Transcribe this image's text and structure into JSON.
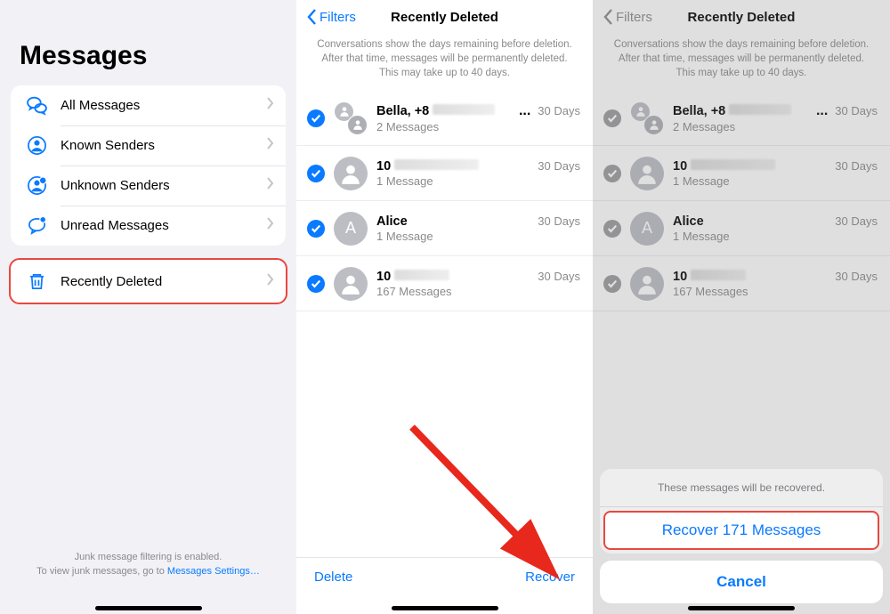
{
  "panel1": {
    "title": "Messages",
    "rows": [
      {
        "label": "All Messages"
      },
      {
        "label": "Known Senders"
      },
      {
        "label": "Unknown Senders"
      },
      {
        "label": "Unread Messages"
      }
    ],
    "deleted_label": "Recently Deleted",
    "footer_line1": "Junk message filtering is enabled.",
    "footer_line2_prefix": "To view junk messages, go to ",
    "footer_link": "Messages Settings…"
  },
  "header": {
    "back": "Filters",
    "title": "Recently Deleted",
    "subtext": "Conversations show the days remaining before deletion. After that time, messages will be permanently deleted. This may take up to 40 days."
  },
  "conversations": [
    {
      "name": "Bella, +8",
      "ellipsis": "...",
      "sub": "2 Messages",
      "days": "30 Days",
      "avatar": "group"
    },
    {
      "name": "10",
      "sub": "1 Message",
      "days": "30 Days",
      "avatar": "person"
    },
    {
      "name": "Alice",
      "sub": "1 Message",
      "days": "30 Days",
      "avatar": "A"
    },
    {
      "name": "10",
      "sub": "167 Messages",
      "days": "30 Days",
      "avatar": "person"
    }
  ],
  "toolbar": {
    "delete": "Delete",
    "recover": "Recover"
  },
  "sheet": {
    "header": "These messages will be recovered.",
    "recover": "Recover 171 Messages",
    "cancel": "Cancel"
  }
}
